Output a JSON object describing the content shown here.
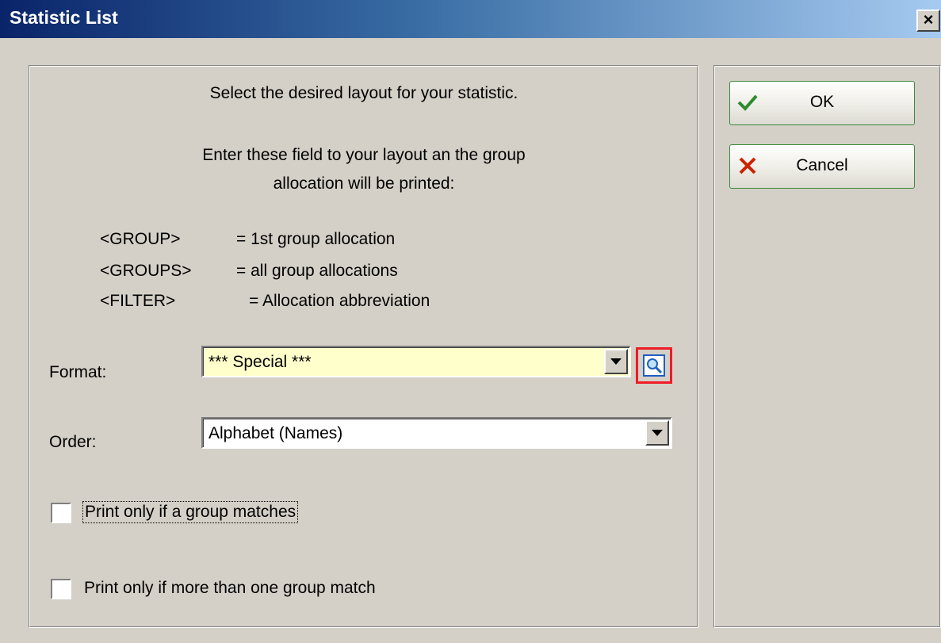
{
  "window": {
    "title": "Statistic List",
    "close_label": "×"
  },
  "instructions": {
    "line1": "Select the desired layout for your statistic.",
    "line2": "Enter these field to your layout an the group",
    "line3": "allocation will be printed:",
    "vars": [
      {
        "name": "<GROUP>",
        "desc": "= 1st group allocation"
      },
      {
        "name": "<GROUPS>",
        "desc": "= all group allocations"
      },
      {
        "name": "<FILTER>",
        "desc": "= Allocation abbreviation"
      }
    ]
  },
  "format": {
    "label": "Format:",
    "value": "*** Special ***",
    "highlight_color": "#ee1c24",
    "background": "#ffffcc"
  },
  "order": {
    "label": "Order:",
    "value": "Alphabet (Names)"
  },
  "checkboxes": [
    {
      "label": "Print only if a group matches",
      "checked": false
    },
    {
      "label": "Print only if more than one group match",
      "checked": false
    }
  ],
  "buttons": {
    "ok": {
      "label": "OK",
      "icon": "checkmark-icon",
      "accent": "#2e8b2e"
    },
    "cancel": {
      "label": "Cancel",
      "icon": "x-icon",
      "accent": "#cc2200"
    }
  }
}
